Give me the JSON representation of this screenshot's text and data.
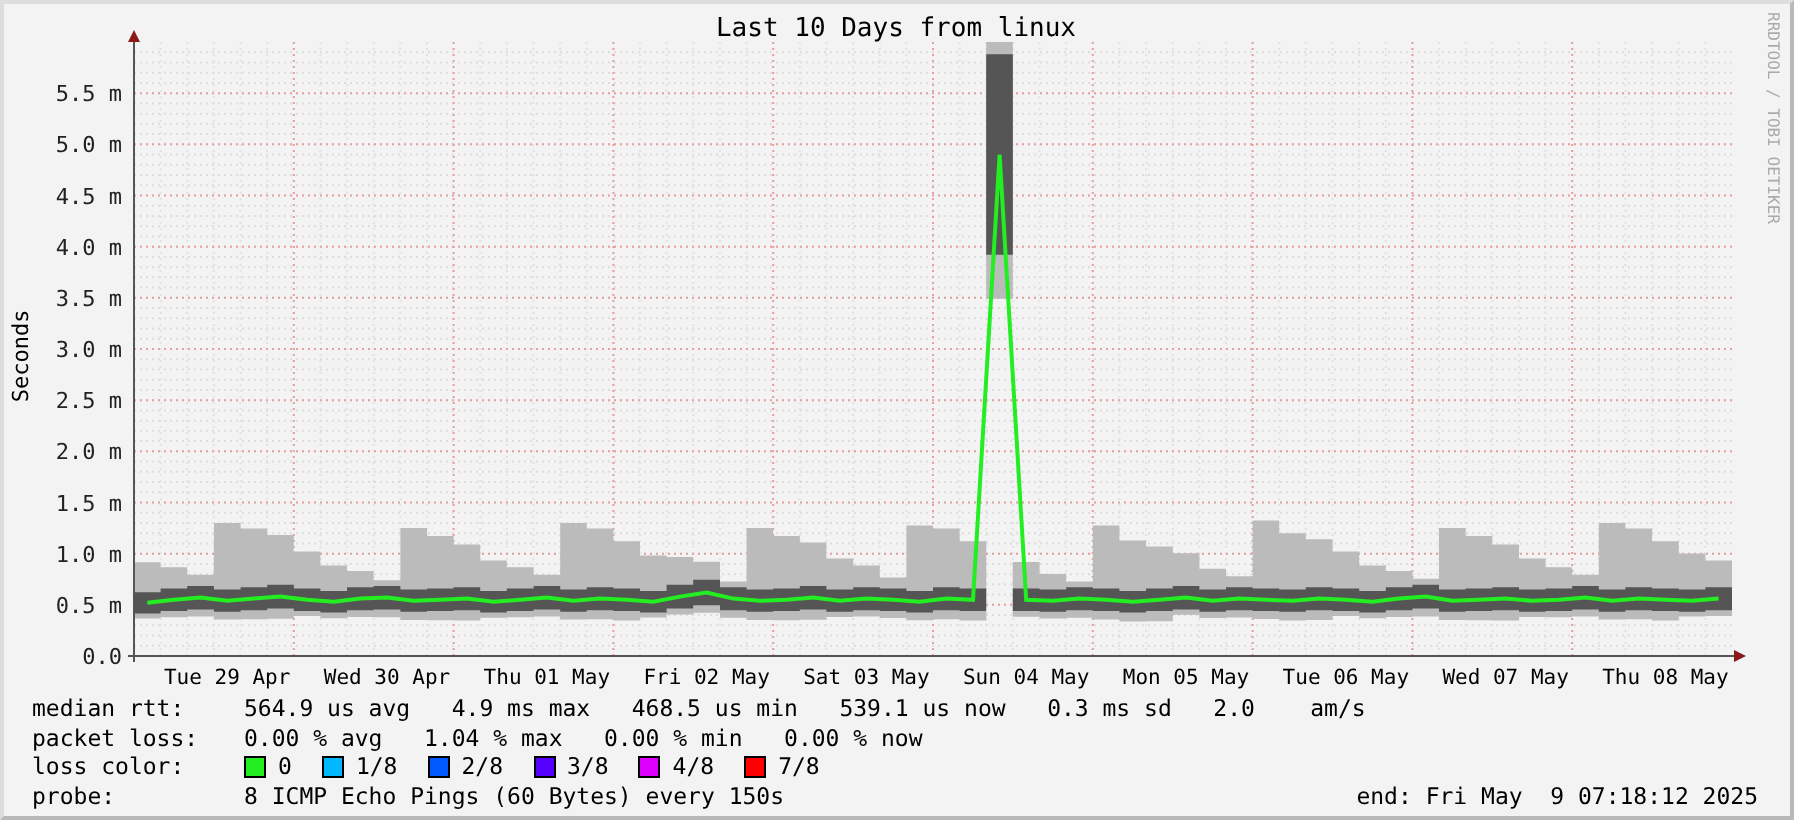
{
  "title": "Last 10 Days from linux",
  "credit": "RRDTOOL / TOBI OETIKER",
  "chart_data": {
    "type": "line",
    "grid": true,
    "ylabel": "Seconds",
    "ylim": [
      0,
      6
    ],
    "categories": [
      null,
      null,
      null,
      "Tue 29 Apr",
      null,
      null,
      null,
      null,
      null,
      "Wed 30 Apr",
      null,
      null,
      null,
      null,
      null,
      "Thu 01 May",
      null,
      null,
      null,
      null,
      null,
      "Fri 02 May",
      null,
      null,
      null,
      null,
      null,
      "Sat 03 May",
      null,
      null,
      null,
      null,
      null,
      "Sun 04 May",
      null,
      null,
      null,
      null,
      null,
      "Mon 05 May",
      null,
      null,
      null,
      null,
      null,
      "Tue 06 May",
      null,
      null,
      null,
      null,
      null,
      "Wed 07 May",
      null,
      null,
      null,
      null,
      null,
      "Thu 08 May",
      null,
      null
    ],
    "yticks": [
      {
        "value": 0,
        "label": "0.0"
      },
      {
        "value": 0.5,
        "label": "0.5 m"
      },
      {
        "value": 1,
        "label": "1.0 m"
      },
      {
        "value": 1.5,
        "label": "1.5 m"
      },
      {
        "value": 2,
        "label": "2.0 m"
      },
      {
        "value": 2.5,
        "label": "2.5 m"
      },
      {
        "value": 3,
        "label": "3.0 m"
      },
      {
        "value": 3.5,
        "label": "3.5 m"
      },
      {
        "value": 4,
        "label": "4.0 m"
      },
      {
        "value": 4.5,
        "label": "4.5 m"
      },
      {
        "value": 5,
        "label": "5.0 m"
      },
      {
        "value": 5.5,
        "label": "5.5 m"
      }
    ],
    "series": [
      {
        "color": "#22ee22",
        "values": [
          0.52,
          0.55,
          0.57,
          0.54,
          0.56,
          0.58,
          0.55,
          0.53,
          0.56,
          0.57,
          0.54,
          0.55,
          0.56,
          0.53,
          0.55,
          0.57,
          0.54,
          0.56,
          0.55,
          0.53,
          0.58,
          0.62,
          0.56,
          0.54,
          0.55,
          0.57,
          0.54,
          0.56,
          0.55,
          0.53,
          0.56,
          0.55,
          4.9,
          0.55,
          0.54,
          0.56,
          0.55,
          0.53,
          0.55,
          0.57,
          0.54,
          0.56,
          0.55,
          0.54,
          0.56,
          0.55,
          0.53,
          0.56,
          0.58,
          0.54,
          0.55,
          0.56,
          0.54,
          0.55,
          0.57,
          0.54,
          0.56,
          0.55,
          0.54,
          0.56
        ]
      }
    ]
  },
  "legend": [
    {
      "kind": "text",
      "label": "median rtt:",
      "text": "564.9 us avg   4.9 ms max   468.5 us min   539.1 us now   0.3 ms sd   2.0    am/s"
    },
    {
      "kind": "text",
      "label": "packet loss:",
      "text": "0.00 % avg   1.04 % max   0.00 % min   0.00 % now"
    },
    {
      "kind": "swatches",
      "label": "loss color:",
      "items": [
        {
          "label": "0",
          "color": "#22ee22"
        },
        {
          "label": "1/8",
          "color": "#00b8ff"
        },
        {
          "label": "2/8",
          "color": "#0059ff"
        },
        {
          "label": "3/8",
          "color": "#5500ff"
        },
        {
          "label": "4/8",
          "color": "#dd00ff"
        },
        {
          "label": "7/8",
          "color": "#ff0000"
        }
      ]
    },
    {
      "kind": "probe",
      "label": "probe:",
      "text": "8 ICMP Echo Pings (60 Bytes) every 150s",
      "end": "end: Fri May  9 07:18:12 2025"
    }
  ]
}
